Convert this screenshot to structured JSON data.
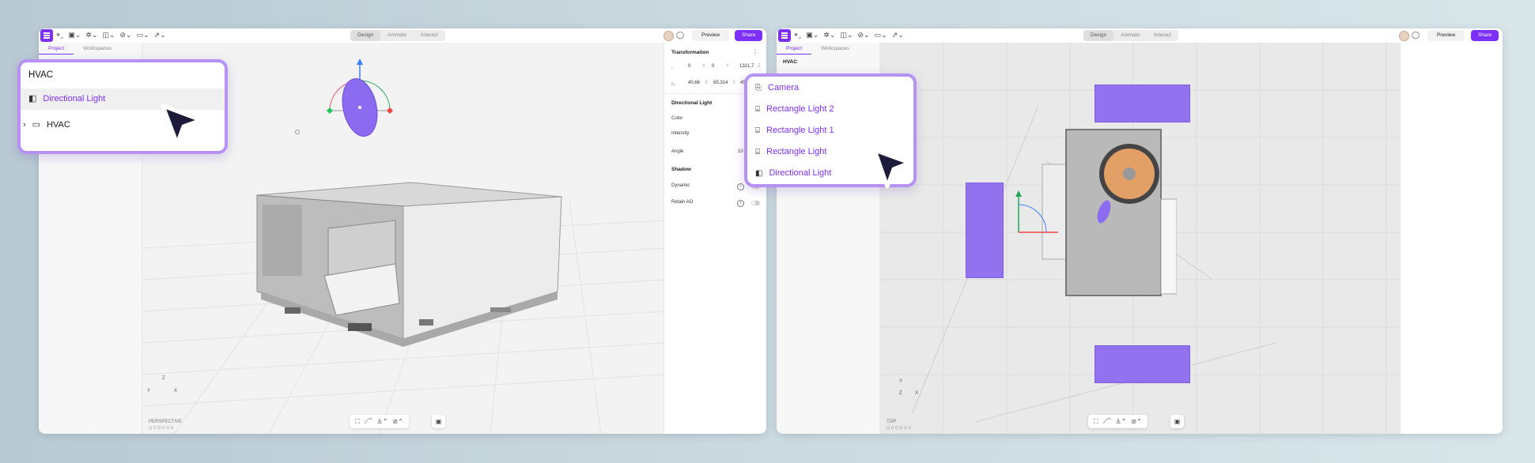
{
  "toolbar": {
    "tool_glyphs": [
      "⌖⌄",
      "▣⌄",
      "✲⌄",
      "◫⌄",
      "⊘⌄",
      "▭⌄",
      "⇗⌄"
    ],
    "modes": [
      "Design",
      "Animate",
      "Interact"
    ],
    "preview_label": "Preview",
    "share_label": "Share"
  },
  "panel_tabs": [
    "Project",
    "Workspaces"
  ],
  "left_window": {
    "project_title": "HVAC",
    "viewport_label": "PERSPECTIVE",
    "viewport_sub": "⊡ 0  ⌬ 0  ⊙ 0",
    "axes": {
      "z": "Z",
      "y": "Y",
      "x": "X"
    },
    "tree_popup": {
      "title": "HVAC",
      "items": [
        {
          "label": "Directional Light",
          "icon": "directional-light-icon",
          "selected": true
        },
        {
          "label": "HVAC",
          "icon": "folder-icon",
          "selected": false
        }
      ]
    },
    "properties": {
      "transformation_title": "Transformation",
      "position": {
        "x": "0",
        "x_axis": "X",
        "y": "0",
        "y_axis": "Y",
        "z": "1321,7",
        "z_axis": "Z"
      },
      "rotation": {
        "x": "40,66",
        "x_axis": "X",
        "y": "65,314",
        "y_axis": "Y",
        "z": "45"
      },
      "section_title": "Directional Light",
      "color_label": "Color",
      "intensity_label": "Intensity",
      "angle_label": "Angle",
      "angle_value": "10",
      "shadow_title": "Shadow",
      "dynamic_label": "Dynamic",
      "retain_ao_label": "Retain AO"
    }
  },
  "right_window": {
    "project_title": "HVAC",
    "viewport_label": "TOP",
    "viewport_sub": "⊡ 0  ⌬ 0  ⊙ 0",
    "axes": {
      "y": "Y",
      "z": "Z",
      "x": "X"
    },
    "lights_popup": {
      "items": [
        {
          "label": "Camera",
          "icon": "camera-icon"
        },
        {
          "label": "Rectangle Light 2",
          "icon": "rectangle-light-icon"
        },
        {
          "label": "Rectangle Light 1",
          "icon": "rectangle-light-icon"
        },
        {
          "label": "Rectangle Light",
          "icon": "rectangle-light-icon"
        },
        {
          "label": "Directional Light",
          "icon": "directional-light-icon"
        }
      ]
    }
  },
  "bottom_toolbar": [
    "⛶",
    "⟋⌃",
    "♙⌃",
    "⊘⌃"
  ],
  "bottom_extra": "▣",
  "colors": {
    "accent": "#7b2ff7",
    "popup_border": "#b792f2",
    "light_fill": "#9272ee"
  }
}
